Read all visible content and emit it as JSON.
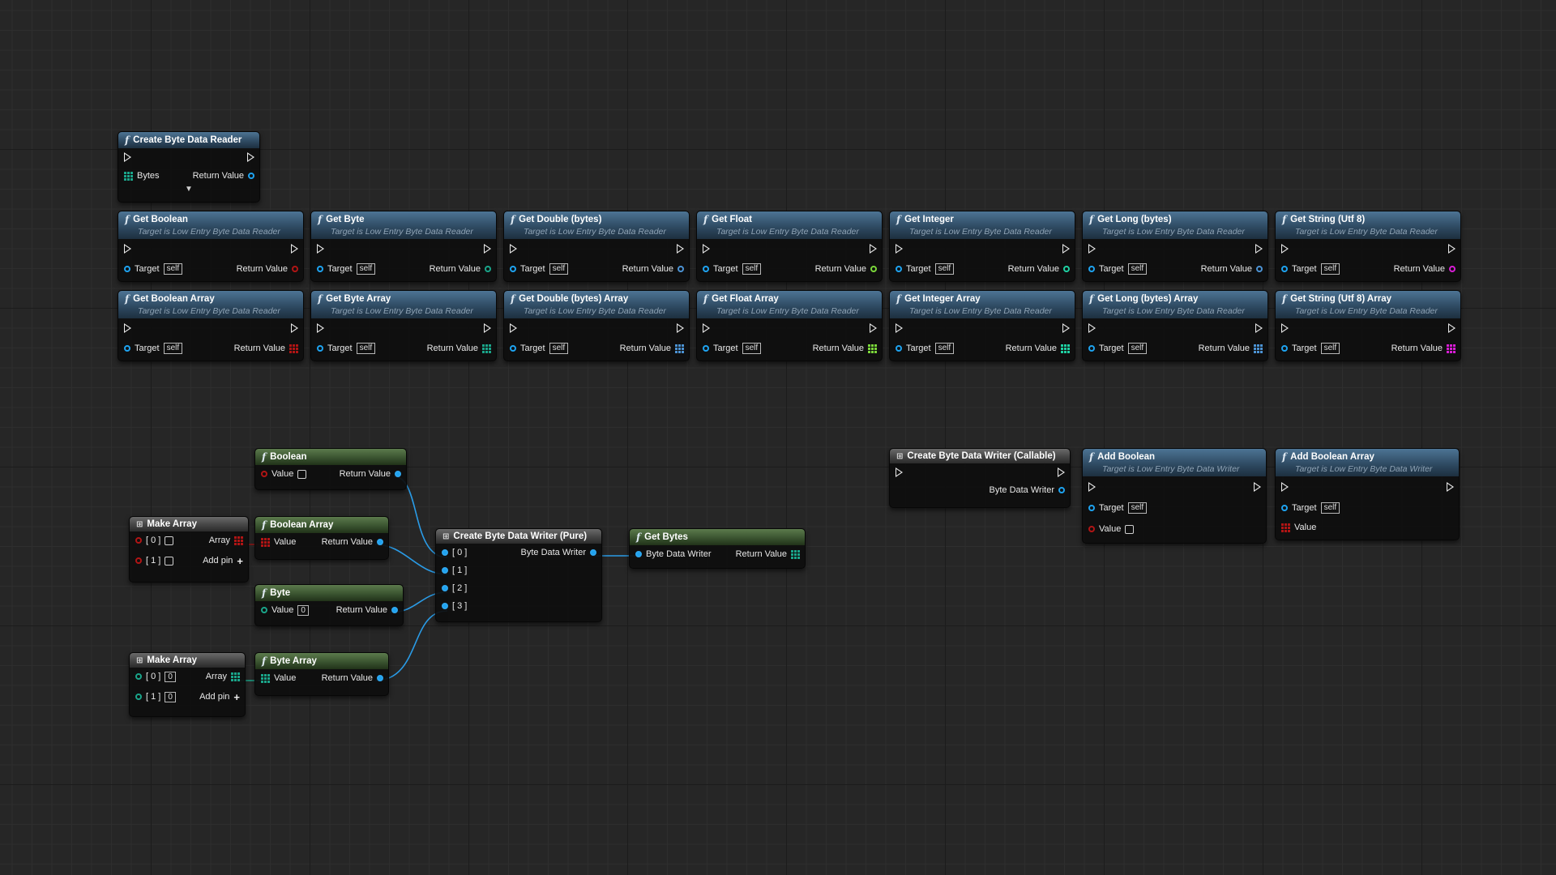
{
  "reader": {
    "title": "Create Byte Data Reader",
    "in_label": "Bytes",
    "out_label": "Return Value"
  },
  "subtitle_reader": "Target is Low Entry Byte Data Reader",
  "subtitle_writer": "Target is Low Entry Byte Data Writer",
  "target_label": "Target",
  "self_label": "self",
  "return_label": "Return Value",
  "value_label": "Value",
  "getters_row1": [
    {
      "title": "Get Boolean",
      "pin_color": "#b01515"
    },
    {
      "title": "Get Byte",
      "pin_color": "#1aa58a"
    },
    {
      "title": "Get Double (bytes)",
      "pin_color": "#4c93d4"
    },
    {
      "title": "Get Float",
      "pin_color": "#7bd73a"
    },
    {
      "title": "Get Integer",
      "pin_color": "#1fd1a3"
    },
    {
      "title": "Get Long (bytes)",
      "pin_color": "#4c93d4"
    },
    {
      "title": "Get String (Utf 8)",
      "pin_color": "#d81dd5"
    }
  ],
  "getters_row2": [
    {
      "title": "Get Boolean Array",
      "pin_color": "#b01515"
    },
    {
      "title": "Get Byte Array",
      "pin_color": "#1aa58a"
    },
    {
      "title": "Get Double (bytes) Array",
      "pin_color": "#4c93d4"
    },
    {
      "title": "Get Float Array",
      "pin_color": "#7bd73a"
    },
    {
      "title": "Get Integer Array",
      "pin_color": "#1fd1a3"
    },
    {
      "title": "Get Long (bytes) Array",
      "pin_color": "#4c93d4"
    },
    {
      "title": "Get String (Utf 8) Array",
      "pin_color": "#d81dd5"
    }
  ],
  "boolean_node": {
    "title": "Boolean"
  },
  "boolean_array_node": {
    "title": "Boolean Array"
  },
  "byte_node": {
    "title": "Byte",
    "value": "0"
  },
  "byte_array_node": {
    "title": "Byte Array"
  },
  "make_array_1": {
    "title": "Make Array",
    "pins": [
      "[ 0 ]",
      "[ 1 ]"
    ],
    "out_label": "Array",
    "add_pin": "Add pin"
  },
  "make_array_2": {
    "title": "Make Array",
    "pins": [
      "[ 0 ]",
      "[ 1 ]"
    ],
    "values": [
      "0",
      "0"
    ],
    "out_label": "Array",
    "add_pin": "Add pin"
  },
  "writer_pure": {
    "title": "Create Byte Data Writer (Pure)",
    "out_label": "Byte Data Writer",
    "pins": [
      "[ 0 ]",
      "[ 1 ]",
      "[ 2 ]",
      "[ 3 ]"
    ]
  },
  "get_bytes": {
    "title": "Get Bytes",
    "in_label": "Byte Data Writer",
    "out_label": "Return Value"
  },
  "writer_callable": {
    "title": "Create Byte Data Writer (Callable)",
    "out_label": "Byte Data Writer"
  },
  "add_boolean": {
    "title": "Add Boolean"
  },
  "add_boolean_array": {
    "title": "Add Boolean Array"
  },
  "colors": {
    "bool": "#b01515",
    "byte": "#1aa58a",
    "object": "#1ea3f0",
    "exec": "#e8e8e8"
  }
}
